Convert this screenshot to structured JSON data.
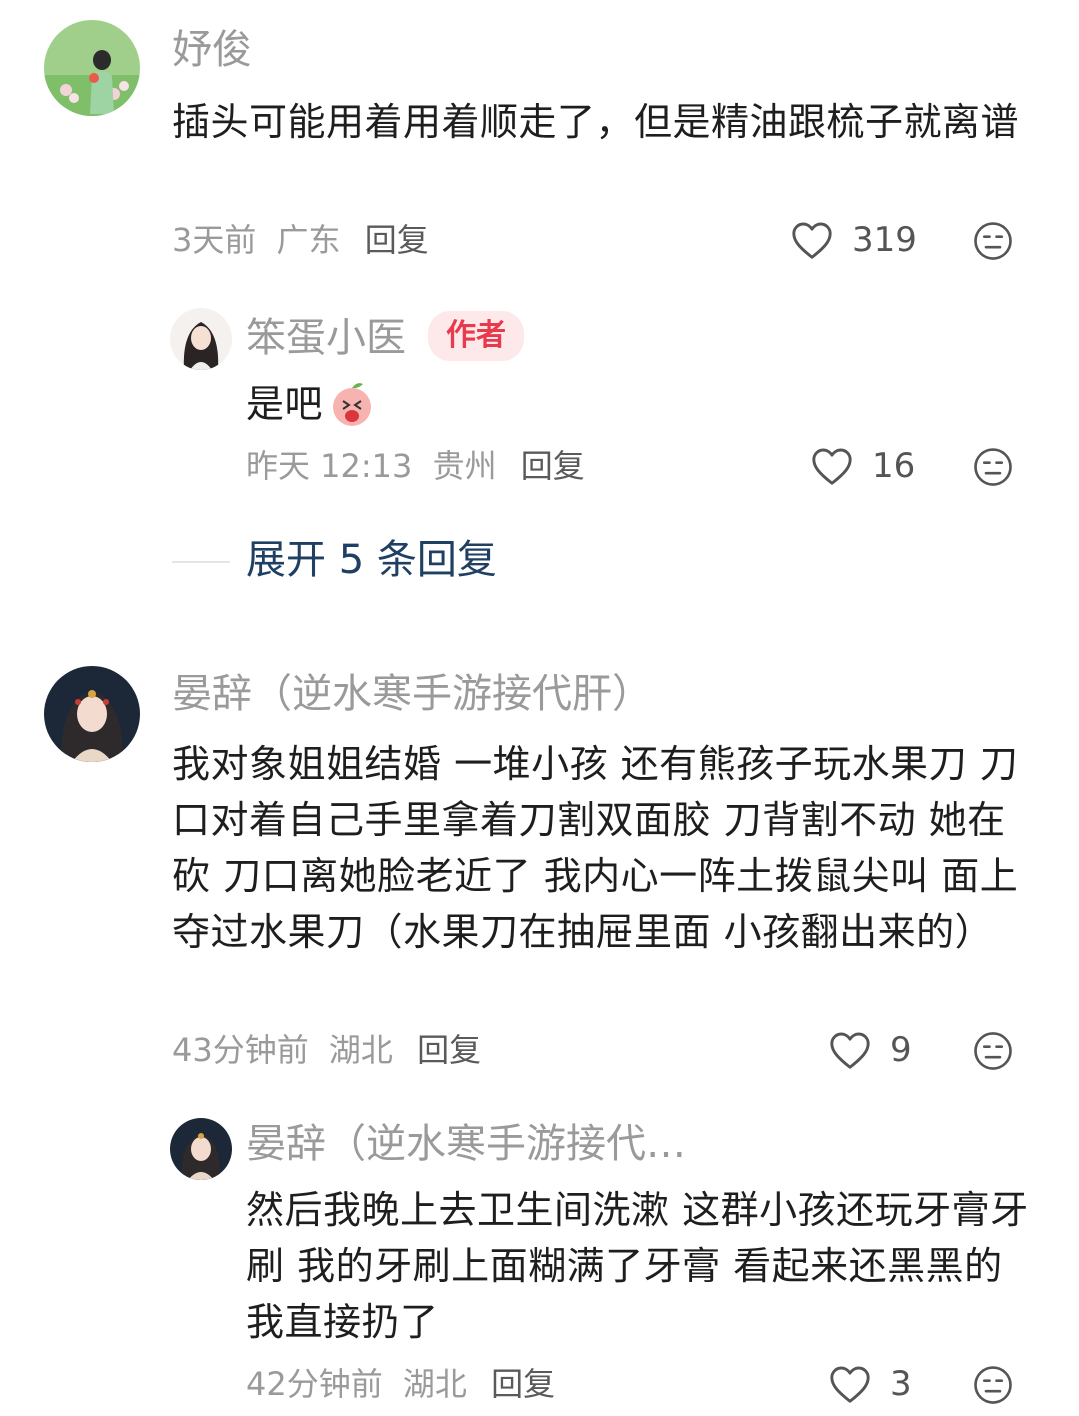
{
  "comments": [
    {
      "username": "妤俊",
      "text": "插头可能用着用着顺走了，但是精油跟梳子就离谱",
      "time": "3天前",
      "location": "广东",
      "reply": "回复",
      "likes": "319",
      "reply_item": {
        "username": "笨蛋小医",
        "badge": "作者",
        "text": "是吧",
        "time": "昨天 12:13",
        "location": "贵州",
        "reply": "回复",
        "likes": "16"
      },
      "expand": "展开 5 条回复"
    },
    {
      "username": "晏辞（逆水寒手游接代肝）",
      "text": "我对象姐姐结婚 一堆小孩 还有熊孩子玩水果刀 刀口对着自己手里拿着刀割双面胶 刀背割不动 她在砍 刀口离她脸老近了 我内心一阵土拨鼠尖叫 面上夺过水果刀（水果刀在抽屉里面 小孩翻出来的）",
      "time": "43分钟前",
      "location": "湖北",
      "reply": "回复",
      "likes": "9",
      "reply_item": {
        "username": "晏辞（逆水寒手游接代…",
        "text": "然后我晚上去卫生间洗漱 这群小孩还玩牙膏牙刷 我的牙刷上面糊满了牙膏 看起来还黑黑的 我直接扔了",
        "time": "42分钟前",
        "location": "湖北",
        "reply": "回复",
        "likes": "3"
      }
    }
  ],
  "icons": {
    "like": "heart-outline-icon",
    "dislike": "meh-face-icon"
  }
}
